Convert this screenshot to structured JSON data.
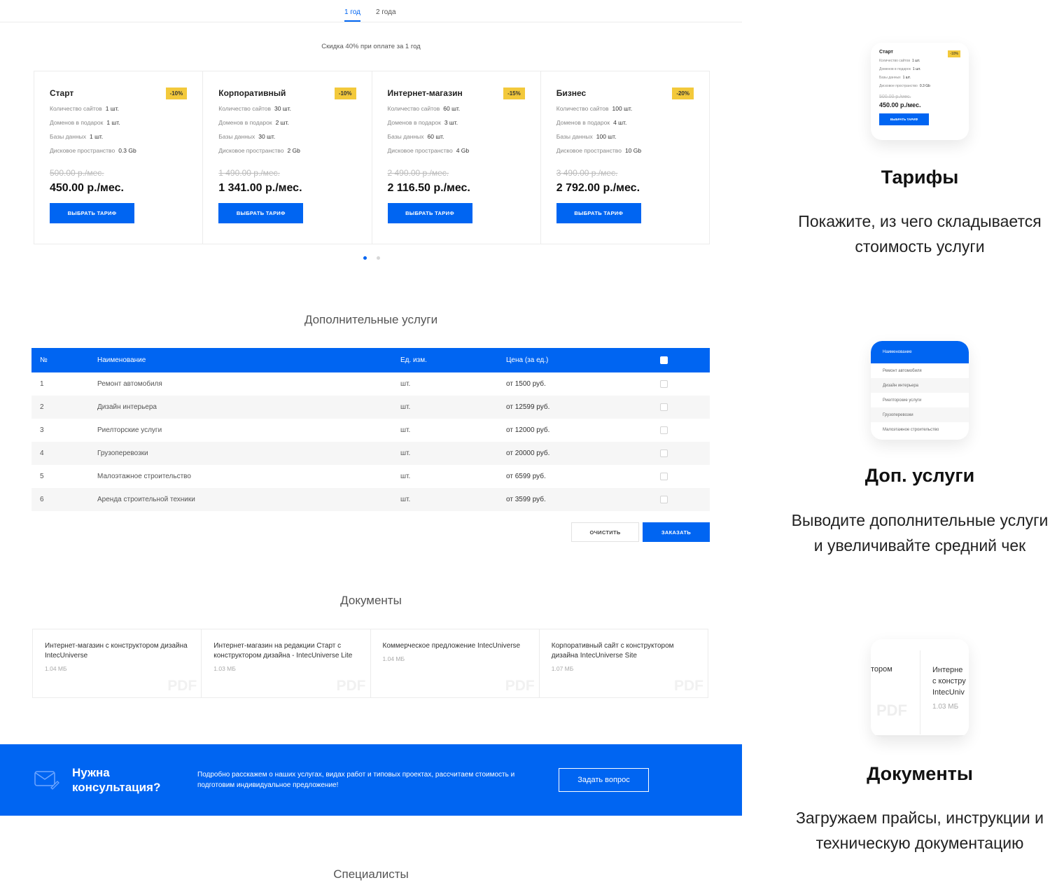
{
  "period_tabs": [
    {
      "label": "1 год",
      "active": true
    },
    {
      "label": "2 года",
      "active": false
    }
  ],
  "discount_note": "Скидка 40% при оплате за 1 год",
  "tariff_button_label": "ВЫБРАТЬ ТАРИФ",
  "tariffs": [
    {
      "name": "Старт",
      "badge": "-10%",
      "features": [
        {
          "label": "Количество сайтов",
          "value": "1 шт."
        },
        {
          "label": "Доменов в подарок",
          "value": "1 шт."
        },
        {
          "label": "Базы данных",
          "value": "1 шт."
        },
        {
          "label": "Дисковое пространство",
          "value": "0.3 Gb"
        }
      ],
      "old_price": "500.00 р./мес.",
      "price": "450.00 р./мес."
    },
    {
      "name": "Корпоративный",
      "badge": "-10%",
      "features": [
        {
          "label": "Количество сайтов",
          "value": "30 шт."
        },
        {
          "label": "Доменов в подарок",
          "value": "2 шт."
        },
        {
          "label": "Базы данных",
          "value": "30 шт."
        },
        {
          "label": "Дисковое пространство",
          "value": "2 Gb"
        }
      ],
      "old_price": "1 490.00 р./мес.",
      "price": "1 341.00 р./мес."
    },
    {
      "name": "Интернет-магазин",
      "badge": "-15%",
      "features": [
        {
          "label": "Количество сайтов",
          "value": "60 шт."
        },
        {
          "label": "Доменов в подарок",
          "value": "3 шт."
        },
        {
          "label": "Базы данных",
          "value": "60 шт."
        },
        {
          "label": "Дисковое пространство",
          "value": "4 Gb"
        }
      ],
      "old_price": "2 490.00 р./мес.",
      "price": "2 116.50 р./мес."
    },
    {
      "name": "Бизнес",
      "badge": "-20%",
      "features": [
        {
          "label": "Количество сайтов",
          "value": "100 шт."
        },
        {
          "label": "Доменов в подарок",
          "value": "4 шт."
        },
        {
          "label": "Базы данных",
          "value": "100 шт."
        },
        {
          "label": "Дисковое пространство",
          "value": "10 Gb"
        }
      ],
      "old_price": "3 490.00 р./мес.",
      "price": "2 792.00 р./мес."
    }
  ],
  "services": {
    "title": "Дополнительные услуги",
    "headers": {
      "num": "№",
      "name": "Наименование",
      "unit": "Ед. изм.",
      "price": "Цена (за ед.)"
    },
    "rows": [
      {
        "num": "1",
        "name": "Ремонт автомобиля",
        "unit": "шт.",
        "price": "от 1500 руб."
      },
      {
        "num": "2",
        "name": "Дизайн интерьера",
        "unit": "шт.",
        "price": "от 12599 руб."
      },
      {
        "num": "3",
        "name": "Риелторские услуги",
        "unit": "шт.",
        "price": "от 12000 руб."
      },
      {
        "num": "4",
        "name": "Грузоперевозки",
        "unit": "шт.",
        "price": "от 20000 руб."
      },
      {
        "num": "5",
        "name": "Малоэтажное строительство",
        "unit": "шт.",
        "price": "от 6599 руб."
      },
      {
        "num": "6",
        "name": "Аренда строительной техники",
        "unit": "шт.",
        "price": "от 3599 руб."
      }
    ],
    "clear_label": "ОЧИСТИТЬ",
    "order_label": "ЗАКАЗАТЬ"
  },
  "documents": {
    "title": "Документы",
    "pdf_watermark": "PDF",
    "items": [
      {
        "title": "Интернет-магазин с конструктором дизайна IntecUniverse",
        "size": "1.04 МБ"
      },
      {
        "title": "Интернет-магазин на редакции Старт с конструктором дизайна - IntecUniverse Lite",
        "size": "1.03 МБ"
      },
      {
        "title": "Коммерческое предложение IntecUniverse",
        "size": "1.04 МБ"
      },
      {
        "title": "Корпоративный сайт с конструктором дизайна IntecUniverse Site",
        "size": "1.07 МБ"
      }
    ]
  },
  "consult": {
    "title": "Нужна консультация?",
    "text": "Подробно расскажем о наших услугах, видах работ и типовых проектах, рассчитаем стоимость и подготовим индивидуальное предложение!",
    "button": "Задать вопрос",
    "icon": "mail-edit-icon"
  },
  "specialists_title": "Специалисты",
  "features": [
    {
      "title": "Тарифы",
      "desc": "Покажите, из чего складывается стоимость услуги"
    },
    {
      "title": "Доп. услуги",
      "desc": "Выводите дополнительные услуги и увеличивайте средний чек"
    },
    {
      "title": "Документы",
      "desc": "Загружаем прайсы, инструкции и техническую документацию"
    }
  ],
  "preview_tariff": {
    "name": "Старт",
    "badge": "-10%",
    "features": [
      {
        "label": "Количество сайтов",
        "value": "1 шт."
      },
      {
        "label": "Доменов в подарок",
        "value": "1 шт."
      },
      {
        "label": "Базы данных",
        "value": "1 шт."
      },
      {
        "label": "Дисковое пространство",
        "value": "0.3 Gb"
      }
    ],
    "old_price": "500.00 р./мес.",
    "price": "450.00 р./мес.",
    "button": "ВЫБРАТЬ ТАРИФ"
  },
  "preview_services": {
    "header": "Наименование",
    "rows": [
      "Ремонт автомобиля",
      "Дизайн интерьера",
      "Риелторские услуги",
      "Грузоперевозки",
      "Малоэтажное строительство"
    ]
  },
  "preview_docs": {
    "left_fragment": "тором",
    "right_lines": [
      "Интерне",
      "с констру",
      "IntecUniv"
    ],
    "size": "1.03 МБ",
    "pdf": "PDF"
  },
  "colors": {
    "accent": "#0065f2",
    "badge": "#f3c93b"
  }
}
